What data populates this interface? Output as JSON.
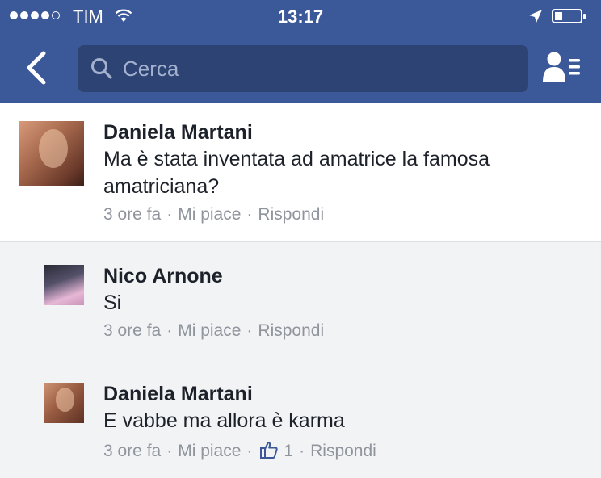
{
  "status_bar": {
    "carrier": "TIM",
    "time": "13:17"
  },
  "nav_bar": {
    "search_placeholder": "Cerca"
  },
  "comments": [
    {
      "author": "Daniela Martani",
      "text_line1": "Ma è stata inventata ad amatrice la famosa",
      "text_line2": "amatriciana?",
      "time": "3 ore fa",
      "like_label": "Mi piace",
      "reply_label": "Rispondi"
    },
    {
      "author": "Nico Arnone",
      "text_line1": "Si",
      "time": "3 ore fa",
      "like_label": "Mi piace",
      "reply_label": "Rispondi"
    },
    {
      "author": "Daniela Martani",
      "text_line1": "E vabbe ma allora è karma",
      "time": "3 ore fa",
      "like_label": "Mi piace",
      "like_count": "1",
      "reply_label": "Rispondi"
    }
  ],
  "separator": "·",
  "icons": {
    "back": "chevron-left-icon",
    "search": "search-icon",
    "friends": "friend-requests-icon",
    "like": "thumbs-up-icon",
    "wifi": "wifi-icon",
    "location": "location-arrow-icon",
    "battery": "battery-icon"
  },
  "colors": {
    "brand": "#3b5998",
    "search_bg": "#2d4373",
    "meta_text": "#90949c",
    "body_text": "#1d2129"
  }
}
